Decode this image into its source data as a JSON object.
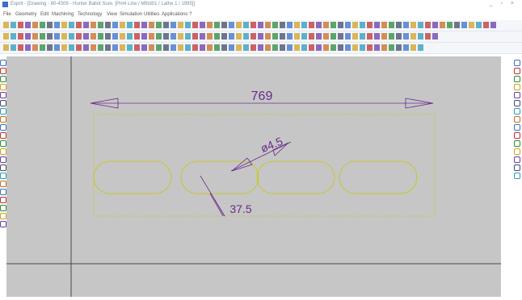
{
  "window": {
    "title": "Esprit - [Drawing - 80-4309 - Hunter Ballot Sure, [Pnt4 Line / Mthd01 / Lathe 1 / 1995]]",
    "controls": "_ ▫ ×"
  },
  "menu": [
    "File",
    "Geometry",
    "Edit",
    "Machining",
    "Technology",
    "View",
    "Simulation",
    "Utilities",
    "Applications",
    "?"
  ],
  "drawing": {
    "dimension_length": "769",
    "dimension_diameter": "ø4.5",
    "dimension_angle": "37.5"
  },
  "colors": {
    "canvas_bg": "#c6c6c6",
    "dimension": "#6a2a8a",
    "geometry": "#c8c800",
    "gridline": "#4a4a4a"
  }
}
